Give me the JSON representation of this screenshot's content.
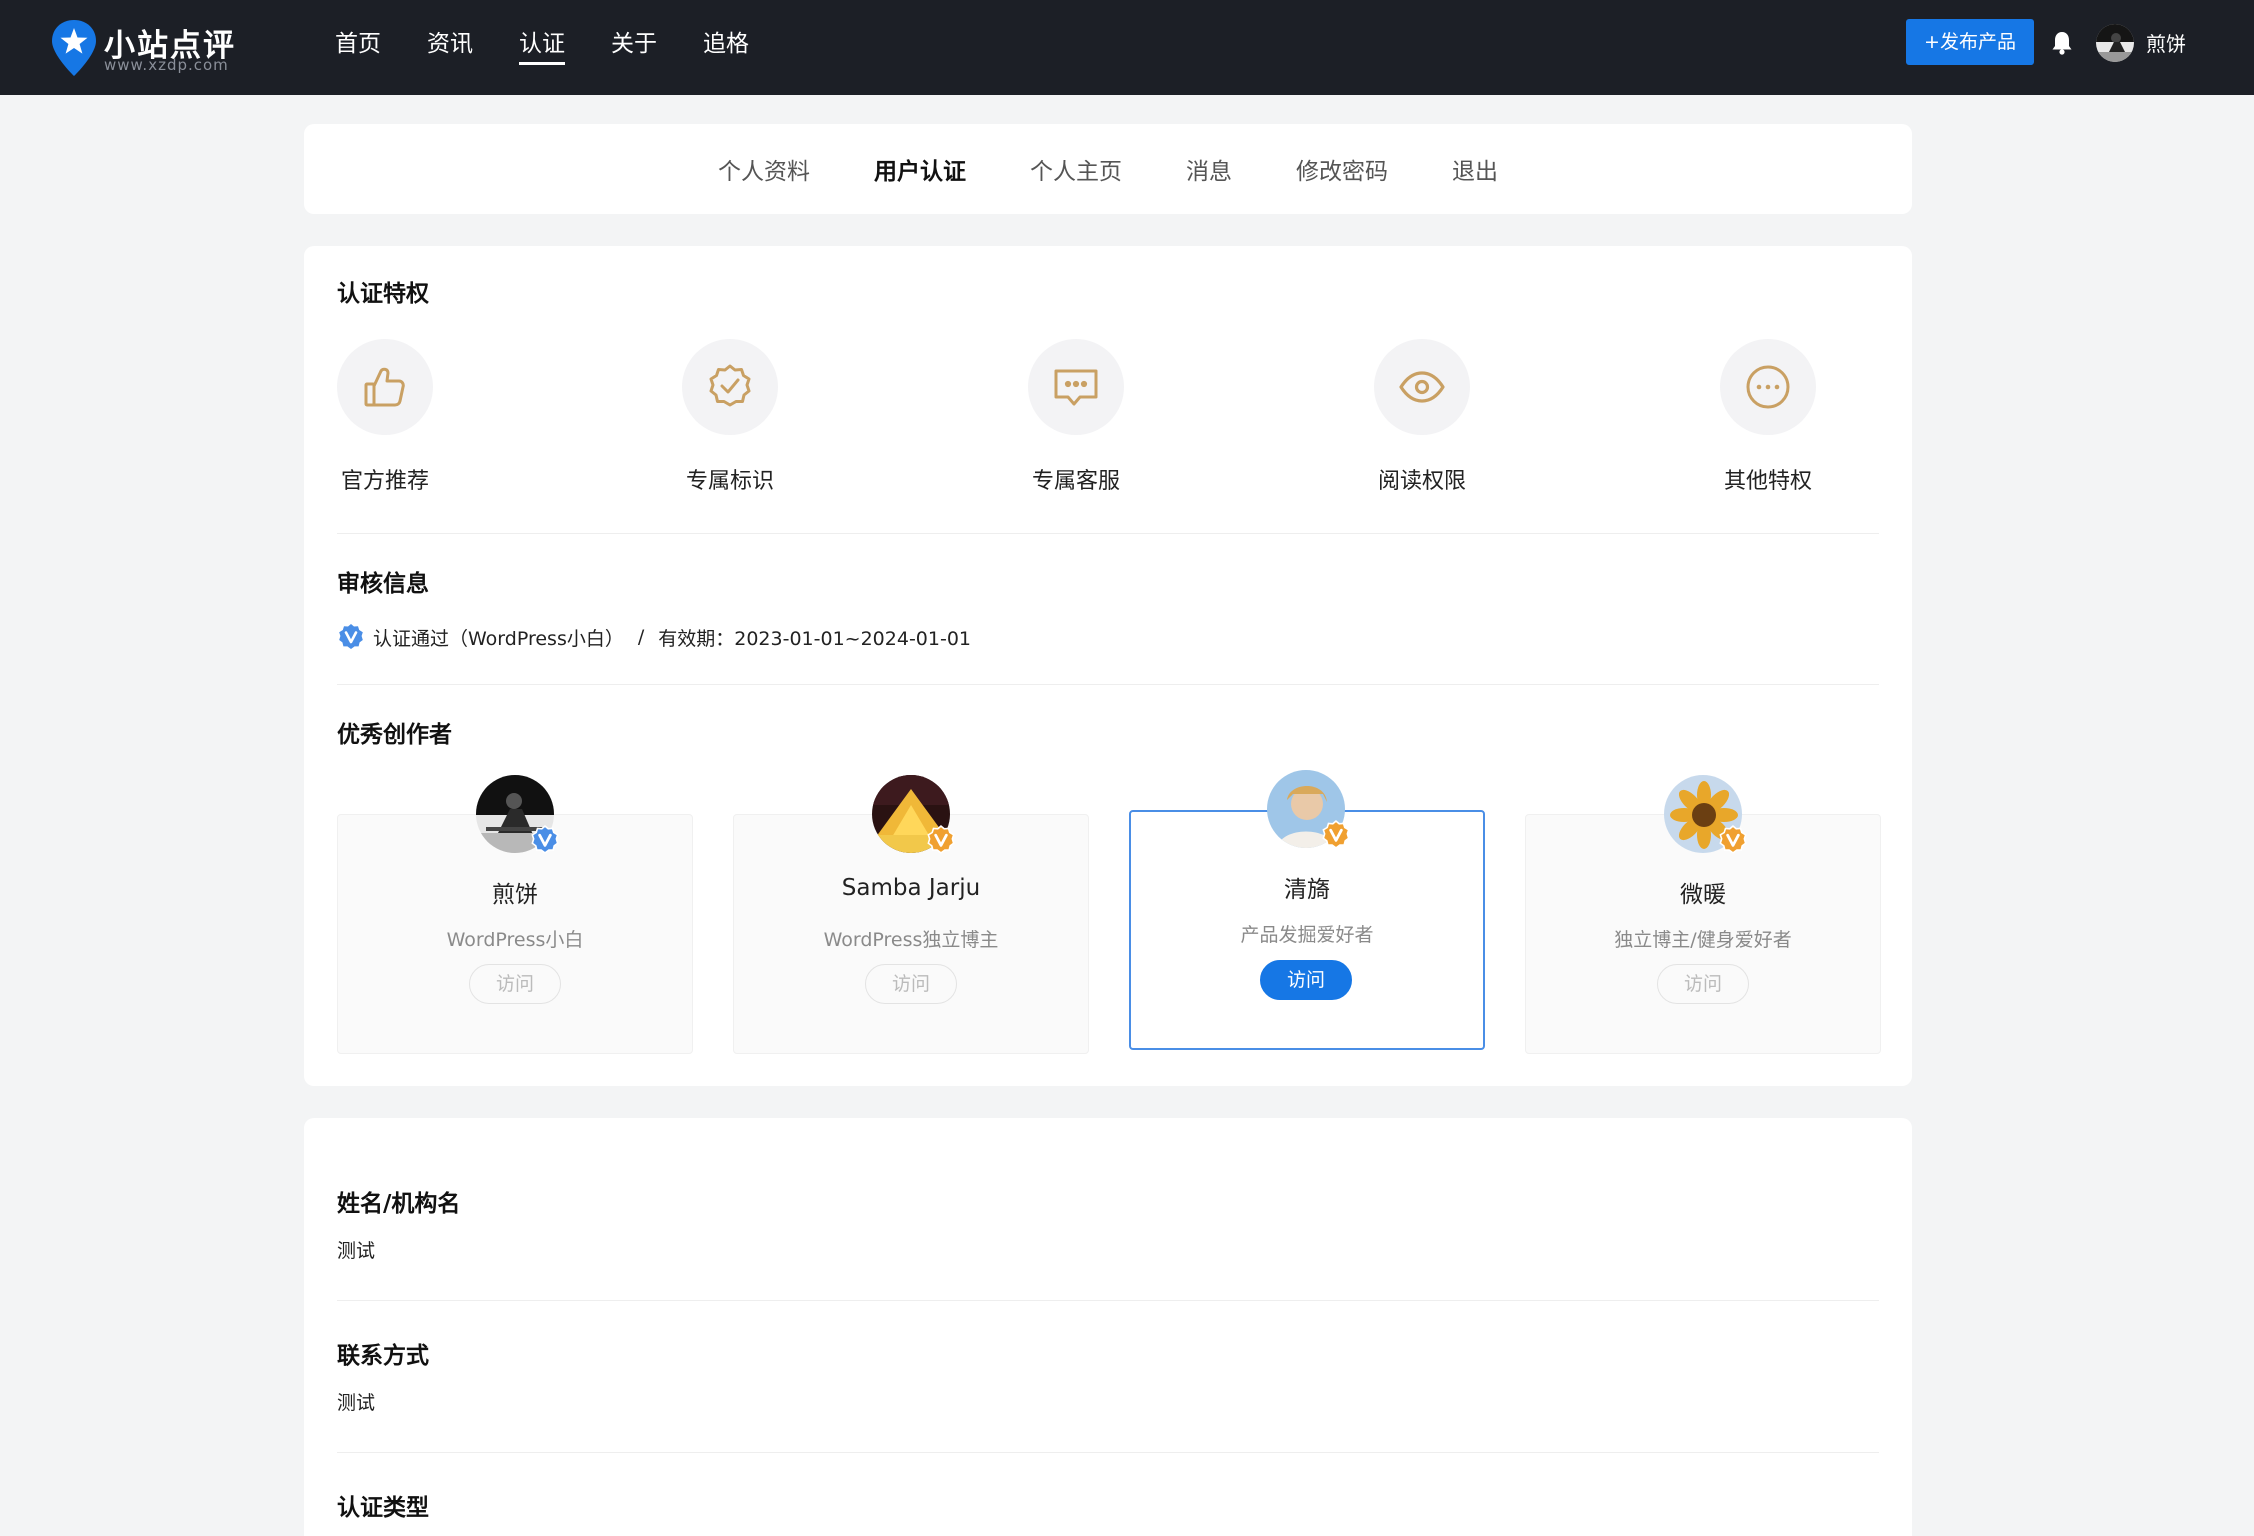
{
  "header": {
    "logo_title": "小站点评",
    "logo_sub": "www.xzdp.com",
    "nav": [
      {
        "label": "首页"
      },
      {
        "label": "资讯"
      },
      {
        "label": "认证",
        "active": true
      },
      {
        "label": "关于"
      },
      {
        "label": "追格"
      }
    ],
    "publish_label": "+发布产品",
    "username": "煎饼"
  },
  "tabs": [
    {
      "label": "个人资料"
    },
    {
      "label": "用户认证",
      "active": true
    },
    {
      "label": "个人主页"
    },
    {
      "label": "消息"
    },
    {
      "label": "修改密码"
    },
    {
      "label": "退出"
    }
  ],
  "privileges": {
    "title": "认证特权",
    "items": [
      {
        "label": "官方推荐",
        "icon": "thumbs-up-icon"
      },
      {
        "label": "专属标识",
        "icon": "verified-badge-icon"
      },
      {
        "label": "专属客服",
        "icon": "chat-bubble-icon"
      },
      {
        "label": "阅读权限",
        "icon": "eye-icon"
      },
      {
        "label": "其他特权",
        "icon": "more-dots-icon"
      }
    ],
    "icon_color": "#c9a063"
  },
  "audit": {
    "title": "审核信息",
    "status": "认证通过（WordPress小白）",
    "separator": "/",
    "validity": "有效期：2023-01-01~2024-01-01"
  },
  "creators": {
    "title": "优秀创作者",
    "items": [
      {
        "name": "煎饼",
        "role": "WordPress小白",
        "button": "访问",
        "badge_color": "#4a8ee6"
      },
      {
        "name": "Samba Jarju",
        "role": "WordPress独立博主",
        "button": "访问",
        "badge_color": "#f0a030"
      },
      {
        "name": "清旖",
        "role": "产品发掘爱好者",
        "button": "访问",
        "badge_color": "#f0a030",
        "active": true
      },
      {
        "name": "微暖",
        "role": "独立博主/健身爱好者",
        "button": "访问",
        "badge_color": "#f0a030"
      }
    ]
  },
  "info": {
    "fields": [
      {
        "label": "姓名/机构名",
        "value": "测试"
      },
      {
        "label": "联系方式",
        "value": "测试"
      },
      {
        "label": "认证类型",
        "value": ""
      }
    ]
  },
  "colors": {
    "accent": "#1677e5",
    "topbar": "#1c1f26"
  }
}
